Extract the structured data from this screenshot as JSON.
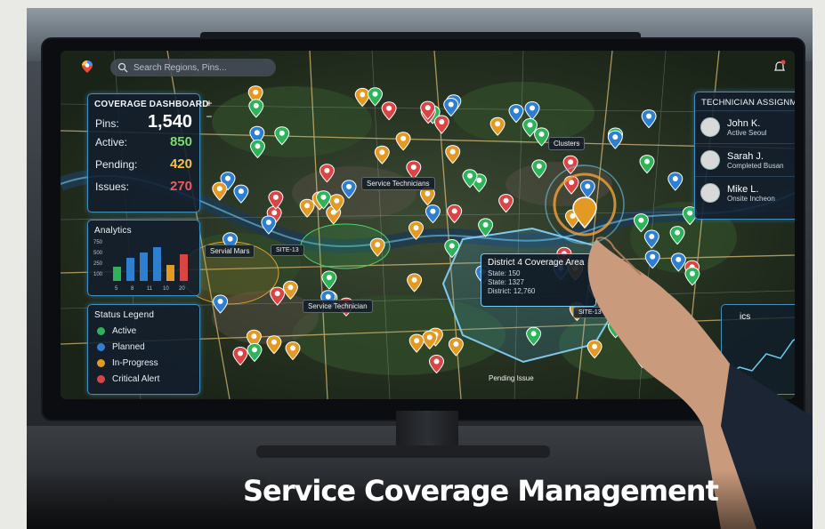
{
  "topbar": {
    "search_placeholder": "Search Regions, Pins..."
  },
  "coverage_dashboard": {
    "title": "COVERAGE DASHBOARD",
    "rows": [
      {
        "label": "Pins:",
        "value": "1,540",
        "color": "#ffffff"
      },
      {
        "label": "Active:",
        "value": "850",
        "color": "#7ddb6a"
      },
      {
        "label": "Pending:",
        "value": "420",
        "color": "#f2c14e"
      },
      {
        "label": "Issues:",
        "value": "270",
        "color": "#f05a5a"
      }
    ]
  },
  "analytics": {
    "title": "Analytics",
    "y_ticks": [
      "750",
      "500",
      "250",
      "100"
    ],
    "x_ticks": [
      "5",
      "8",
      "11",
      "10",
      "20"
    ]
  },
  "status_legend": {
    "title": "Status Legend",
    "items": [
      {
        "label": "Active",
        "color": "#2fb35a"
      },
      {
        "label": "Planned",
        "color": "#2f7fd0"
      },
      {
        "label": "In-Progress",
        "color": "#e39a25"
      },
      {
        "label": "Critical Alert",
        "color": "#d94545"
      }
    ]
  },
  "technician_assignment": {
    "title": "TECHNICIAN ASSIGNMENT",
    "technicians": [
      {
        "name": "John K.",
        "status": "Active Seoul",
        "pin_color": "#3ac35a"
      },
      {
        "name": "Sarah J.",
        "status": "Completed Busan",
        "pin_color": "#3ac35a"
      },
      {
        "name": "Mike L.",
        "status": "Onsite Incheon",
        "pin_color": "#e24848"
      }
    ]
  },
  "map_labels": {
    "clusters": "Clusters",
    "service_technicians": "Service Technicians",
    "service_technician": "Service Technician",
    "servial_mars": "Servial Mars",
    "site_13_a": "SITE-13",
    "site_13_b": "SITE-13",
    "pending_issue": "Pending Issue",
    "district_title": "District 4 Coverage Area",
    "district_lines": [
      "State: 150",
      "State: 1327",
      "District: 12,760"
    ]
  },
  "mini_panel": {
    "title": "ics"
  },
  "caption": "Service Coverage Management",
  "colors": {
    "accent": "#3f8fbf",
    "active": "#2fb35a",
    "planned": "#2f7fd0",
    "in_progress": "#e39a25",
    "critical": "#d94545",
    "district_outline": "#7fc9ee"
  }
}
